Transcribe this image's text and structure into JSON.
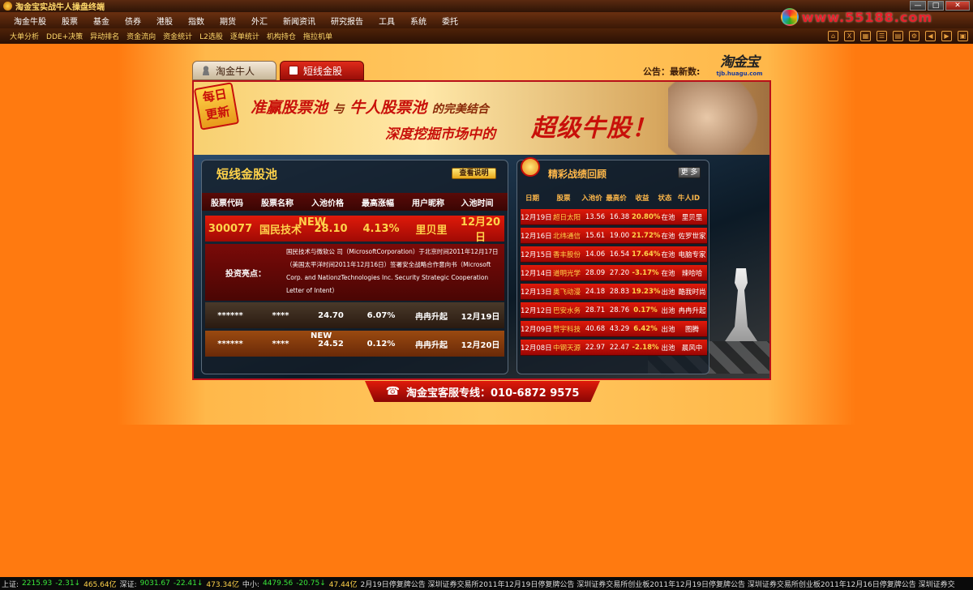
{
  "window": {
    "title": "淘金宝实战牛人操盘终端",
    "buttons": {
      "minimize": "—",
      "maximize": "□",
      "close": "✕"
    }
  },
  "menu": [
    "淘金牛股",
    "股票",
    "基金",
    "债券",
    "港股",
    "指数",
    "期货",
    "外汇",
    "新闻资讯",
    "研究报告",
    "工具",
    "系统",
    "委托"
  ],
  "brand": {
    "url": "www.55188.com"
  },
  "toolbar": [
    "大单分析",
    "DDE+决策",
    "异动排名",
    "资金流向",
    "资金统计",
    "L2选股",
    "逐单统计",
    "机构持仓",
    "拖拉机单"
  ],
  "tabs": [
    {
      "label": "淘金牛人"
    },
    {
      "label": "短线金股"
    }
  ],
  "notice": "公告：最新数:",
  "logo": {
    "name": "淘金宝",
    "sub": "tjb.huagu.com"
  },
  "banner": {
    "badge1": "每日",
    "badge2": "更新",
    "line1a": "准赢股票池",
    "line1b": "与",
    "line1c": "牛人股票池",
    "line1d": "的完美结合",
    "line2": "深度挖掘市场中的",
    "line3": "超级牛股！"
  },
  "pool": {
    "title": "短线金股池",
    "explain_btn": "查看说明",
    "columns": [
      "股票代码",
      "股票名称",
      "入池价格",
      "最高涨幅",
      "用户昵称",
      "入池时间"
    ],
    "hot": {
      "code": "300077",
      "name": "国民技术",
      "badge": "NEW",
      "price": "28.10",
      "rise": "4.13%",
      "user": "里贝里",
      "date": "12月20日"
    },
    "highlight_label": "投资亮点：",
    "highlight_text": "国民技术与微软公 司（MicrosoftCorporation）于北京时间2011年12月17日（美国太平洋时间2011年12月16日）签署安全战略合作意向书（Microsoft Corp. and NationzTechnologies Inc. Security Strategic Cooperation Letter of Intent）",
    "rows": [
      {
        "code": "******",
        "name": "****",
        "badge": "",
        "price": "24.70",
        "rise": "6.07%",
        "user": "冉冉升起",
        "date": "12月19日"
      },
      {
        "code": "******",
        "name": "****",
        "badge": "NEW",
        "price": "24.52",
        "rise": "0.12%",
        "user": "冉冉升起",
        "date": "12月20日"
      }
    ]
  },
  "review": {
    "title": "精彩战绩回顾",
    "more_btn": "更 多",
    "columns": [
      "日期",
      "股票",
      "入池价",
      "最高价",
      "收益",
      "状态",
      "牛人ID"
    ],
    "rows": [
      {
        "date": "12月19日",
        "name": "超日太阳",
        "in": "13.56",
        "high": "16.38",
        "profit": "20.80%",
        "status": "在池",
        "user": "里贝里"
      },
      {
        "date": "12月16日",
        "name": "北纬通信",
        "in": "15.61",
        "high": "19.00",
        "profit": "21.72%",
        "status": "在池",
        "user": "佐罗世家"
      },
      {
        "date": "12月15日",
        "name": "香丰股份",
        "in": "14.06",
        "high": "16.54",
        "profit": "17.64%",
        "status": "在池",
        "user": "电脑专家"
      },
      {
        "date": "12月14日",
        "name": "道明光学",
        "in": "28.09",
        "high": "27.20",
        "profit": "-3.17%",
        "status": "在池",
        "user": "辣哈哈"
      },
      {
        "date": "12月13日",
        "name": "奥飞动漫",
        "in": "24.18",
        "high": "28.83",
        "profit": "19.23%",
        "status": "出池",
        "user": "酷我时尚"
      },
      {
        "date": "12月12日",
        "name": "巴安水务",
        "in": "28.71",
        "high": "28.76",
        "profit": "0.17%",
        "status": "出池",
        "user": "冉冉升起"
      },
      {
        "date": "12月09日",
        "name": "赞宇科技",
        "in": "40.68",
        "high": "43.29",
        "profit": "6.42%",
        "status": "出池",
        "user": "图腾"
      },
      {
        "date": "12月08日",
        "name": "中钢天源",
        "in": "22.97",
        "high": "22.47",
        "profit": "-2.18%",
        "status": "出池",
        "user": "晨风中"
      }
    ]
  },
  "hotline": "淘金宝客服专线：010-6872 9575",
  "status": {
    "sh_label": "上证:",
    "sh": "2215.93",
    "sh_chg": "-2.31↓",
    "sh_amt": "465.64亿",
    "sz_label": "深证:",
    "sz": "9031.67",
    "sz_chg": "-22.41↓",
    "sz_amt": "473.34亿",
    "zx_label": "中小:",
    "zx": "4479.56",
    "zx_chg": "-20.75↓",
    "zx_amt": "47.44亿",
    "news": "2月19日停复牌公告  深圳证券交易所2011年12月19日停复牌公告  深圳证券交易所创业板2011年12月19日停复牌公告  深圳证券交易所创业板2011年12月16日停复牌公告  深圳证券交"
  }
}
